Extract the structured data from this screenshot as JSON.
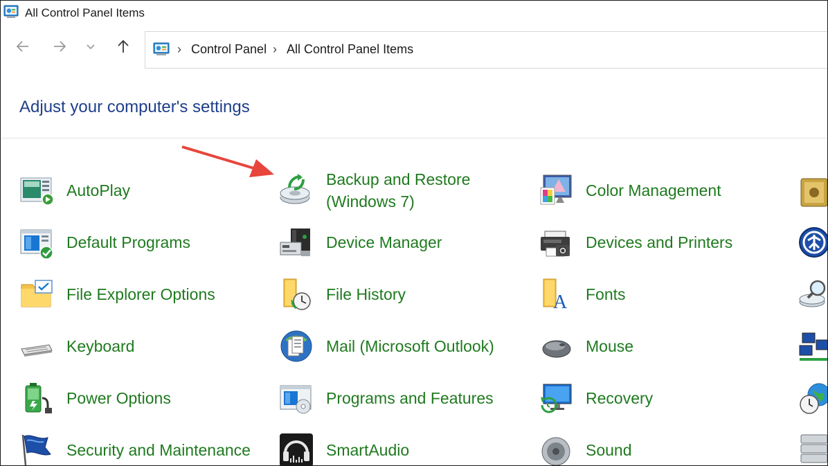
{
  "window": {
    "title": "All Control Panel Items"
  },
  "breadcrumb": [
    "Control Panel",
    "All Control Panel Items"
  ],
  "heading": "Adjust your computer's settings",
  "items": [
    {
      "label": "AutoPlay",
      "icon": "autoplay-icon"
    },
    {
      "label": "Backup and Restore",
      "label2": "(Windows 7)",
      "icon": "backup-restore-icon"
    },
    {
      "label": "Color Management",
      "icon": "color-management-icon"
    },
    {
      "label": "Default Programs",
      "icon": "default-programs-icon"
    },
    {
      "label": "Device Manager",
      "icon": "device-manager-icon"
    },
    {
      "label": "Devices and Printers",
      "icon": "devices-printers-icon"
    },
    {
      "label": "File Explorer Options",
      "icon": "file-explorer-options-icon"
    },
    {
      "label": "File History",
      "icon": "file-history-icon"
    },
    {
      "label": "Fonts",
      "icon": "fonts-icon"
    },
    {
      "label": "Keyboard",
      "icon": "keyboard-icon"
    },
    {
      "label": "Mail (Microsoft Outlook)",
      "icon": "mail-icon"
    },
    {
      "label": "Mouse",
      "icon": "mouse-icon"
    },
    {
      "label": "Power Options",
      "icon": "power-options-icon"
    },
    {
      "label": "Programs and Features",
      "icon": "programs-features-icon"
    },
    {
      "label": "Recovery",
      "icon": "recovery-icon"
    },
    {
      "label": "Security and Maintenance",
      "icon": "security-maintenance-icon"
    },
    {
      "label": "SmartAudio",
      "icon": "smartaudio-icon"
    },
    {
      "label": "Sound",
      "icon": "sound-icon"
    }
  ],
  "colors": {
    "link": "#1f7a1f",
    "heading": "#1e3f8a",
    "annotation_arrow": "#e8453c"
  }
}
